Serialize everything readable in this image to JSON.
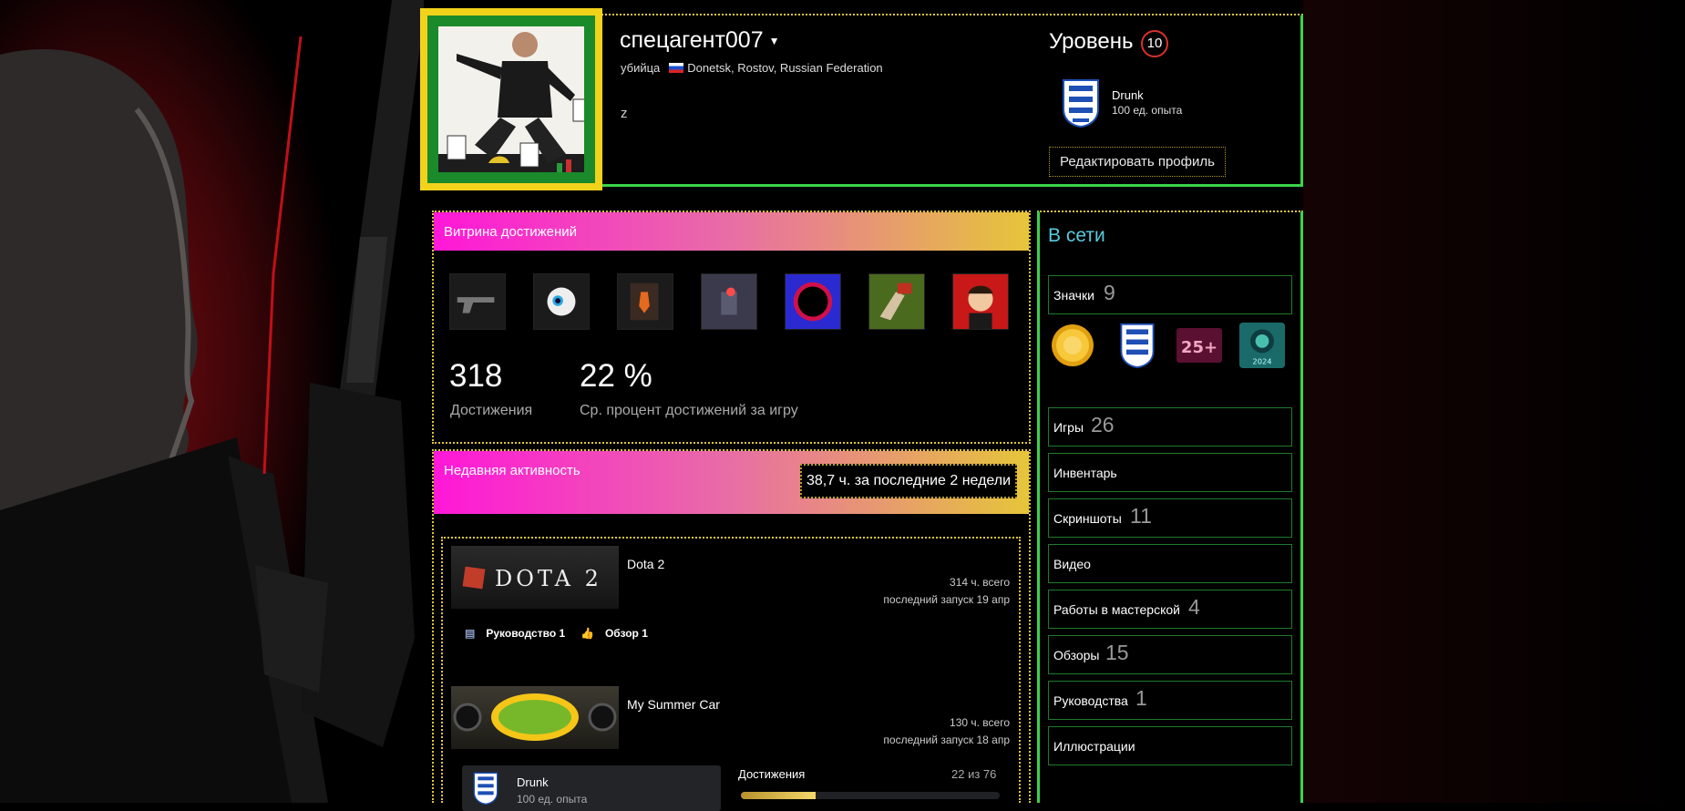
{
  "profile": {
    "persona_name": "спецагент007",
    "real_name": "убийца",
    "location": "Donetsk, Rostov, Russian Federation",
    "summary": "z"
  },
  "level": {
    "label": "Уровень",
    "value": "10"
  },
  "favorite_badge": {
    "name": "Drunk",
    "xp": "100 ед. опыта"
  },
  "buttons": {
    "edit_profile": "Редактировать профиль"
  },
  "showcase": {
    "title": "Витрина достижений",
    "achievements_count": "318",
    "achievements_label": "Достижения",
    "avg_percent": "22 %",
    "avg_percent_label": "Ср. процент достижений за игру"
  },
  "recent": {
    "title": "Недавняя активность",
    "hours": "38,7 ч. за последние 2 недели",
    "games": [
      {
        "name": "Dota 2",
        "total_hours": "314 ч. всего",
        "last_played": "последний запуск 19 апр",
        "guides": "Руководство 1",
        "reviews": "Обзор 1",
        "capsule_text": "DOTA 2"
      },
      {
        "name": "My Summer Car",
        "total_hours": "130 ч. всего",
        "last_played": "последний запуск 18 апр",
        "badge_name": "Drunk",
        "badge_xp": "100 ед. опыта",
        "achievements_label": "Достижения",
        "achievements_progress": "22 из 76",
        "achievements_fraction": 0.289
      }
    ]
  },
  "sidebar": {
    "status": "В сети",
    "badges_label": "Значки",
    "badges_count": "9",
    "badge_25_text": "25+",
    "badge_2024_text": "2024",
    "items": [
      {
        "label": "Игры",
        "count": "26"
      },
      {
        "label": "Инвентарь",
        "count": ""
      },
      {
        "label": "Скриншоты",
        "count": "11"
      },
      {
        "label": "Видео",
        "count": ""
      },
      {
        "label": "Работы в мастерской",
        "count": "4"
      },
      {
        "label": "Обзоры",
        "count": "15"
      },
      {
        "label": "Руководства",
        "count": "1"
      },
      {
        "label": "Иллюстрации",
        "count": ""
      }
    ]
  },
  "colors": {
    "accent_green": "#3bd44a",
    "dotted_border": "#e0c53a",
    "online": "#57cbde",
    "level_ring": "#d6322c"
  }
}
